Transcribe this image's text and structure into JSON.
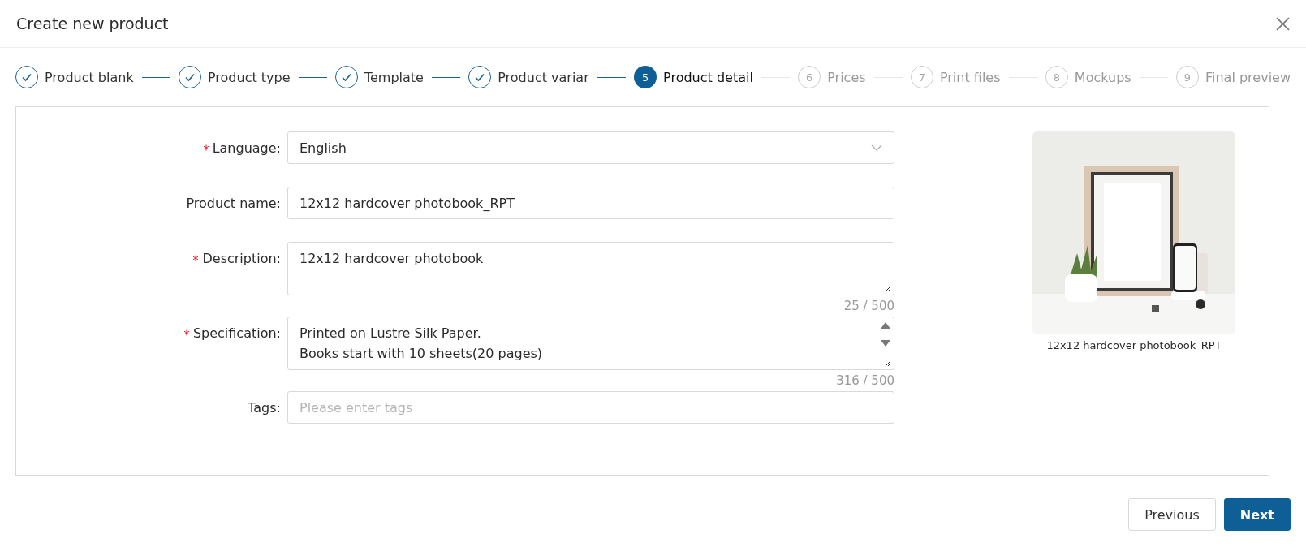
{
  "dialog": {
    "title": "Create new product"
  },
  "steps": [
    {
      "label": "Product blank",
      "completed": true,
      "selected": false
    },
    {
      "label": "Product type",
      "completed": true,
      "selected": false
    },
    {
      "label": "Template",
      "completed": true,
      "selected": false
    },
    {
      "label": "Product variar",
      "completed": true,
      "selected": false
    },
    {
      "number": "5",
      "label": "Product detail",
      "completed": false,
      "selected": true
    },
    {
      "number": "6",
      "label": "Prices",
      "completed": false,
      "selected": false
    },
    {
      "number": "7",
      "label": "Print files",
      "completed": false,
      "selected": false
    },
    {
      "number": "8",
      "label": "Mockups",
      "completed": false,
      "selected": false
    },
    {
      "number": "9",
      "label": "Final preview",
      "completed": false,
      "selected": false
    }
  ],
  "form": [
    {
      "kind": "select",
      "label": "Language:",
      "required": true,
      "value": "English"
    },
    {
      "kind": "input",
      "label": "Product name:",
      "required": false,
      "value": "12x12 hardcover photobook_RPT"
    },
    {
      "kind": "textarea",
      "label": "Description:",
      "required": true,
      "lines": [
        "12x12 hardcover photobook"
      ],
      "counter": "25 / 500"
    },
    {
      "kind": "scroll_textarea",
      "label": "Specification:",
      "required": true,
      "lines": [
        "Printed on Lustre Silk Paper.",
        "Books start with 10 sheets(20 pages)"
      ],
      "counter": "316 / 500"
    },
    {
      "kind": "input",
      "label": "Tags:",
      "required": false,
      "placeholder": "Please enter tags"
    }
  ],
  "preview": {
    "caption": "12x12 hardcover photobook_RPT"
  },
  "buttons": [
    {
      "label": "Previous",
      "kind": "secondary"
    },
    {
      "label": "Next",
      "kind": "primary"
    }
  ]
}
